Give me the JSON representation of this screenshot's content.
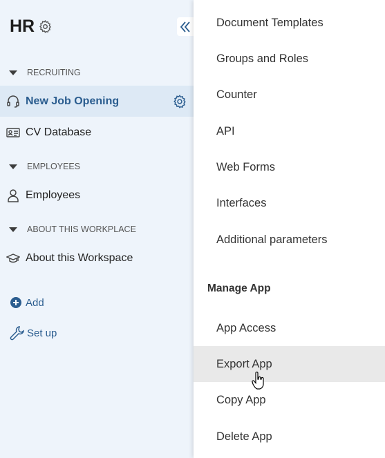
{
  "app": {
    "title": "HR"
  },
  "sidebar": {
    "sections": [
      {
        "header": "RECRUITING",
        "items": [
          {
            "label": "New Job Opening",
            "icon": "headset-icon",
            "active": true
          },
          {
            "label": "CV Database",
            "icon": "id-card-icon",
            "active": false
          }
        ]
      },
      {
        "header": "EMPLOYEES",
        "items": [
          {
            "label": "Employees",
            "icon": "person-icon",
            "active": false
          }
        ]
      },
      {
        "header": "ABOUT THIS WORKPLACE",
        "items": [
          {
            "label": "About this Workspace",
            "icon": "graduation-cap-icon",
            "active": false
          }
        ]
      }
    ],
    "actions": {
      "add_label": "Add",
      "setup_label": "Set up"
    }
  },
  "menu": {
    "items": [
      "Document Templates",
      "Groups and Roles",
      "Counter",
      "API",
      "Web Forms",
      "Interfaces",
      "Additional parameters"
    ],
    "manage_heading": "Manage App",
    "manage_items": [
      "App Access",
      "Export App",
      "Copy App",
      "Delete App"
    ],
    "hovered_item": "Export App"
  },
  "colors": {
    "accent": "#2b5d8f",
    "sidebar_bg": "#eef4fb",
    "active_bg": "#dde9f5",
    "hover_bg": "#e9e9e9"
  }
}
